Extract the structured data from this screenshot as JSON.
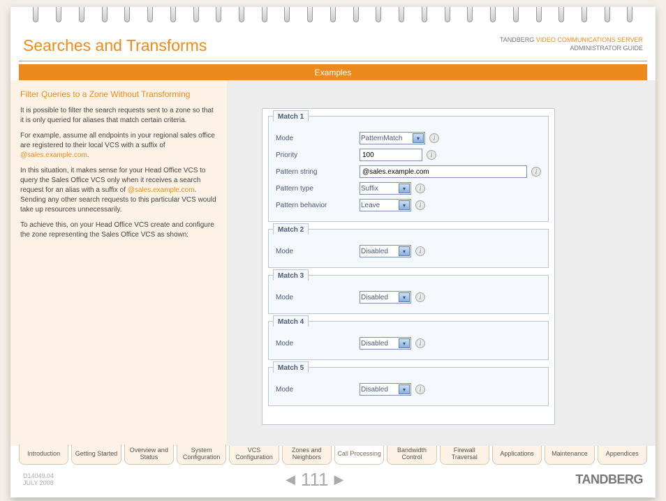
{
  "header": {
    "title": "Searches and Transforms",
    "product_line1_a": "TANDBERG",
    "product_line1_b": "VIDEO COMMUNICATIONS SERVER",
    "product_line2": "ADMINISTRATOR GUIDE",
    "bar_label": "Examples"
  },
  "left": {
    "heading": "Filter Queries to a Zone Without Transforming",
    "p1": "It is possible to filter the search requests sent to a zone so that it is only queried for aliases that match certain criteria.",
    "p2a": "For example, assume all endpoints in your regional sales office are registered to their local VCS with a suffix of ",
    "p2_link": "@sales.example.com",
    "p2b": ".",
    "p3a": "In this situation, it makes sense for your Head Office VCS to query the Sales Office VCS only when it receives a search request for an alias with a suffix of ",
    "p3_link": "@sales.example.com",
    "p3b": ". Sending any other search requests to this particular VCS would take up resources unnecessarily.",
    "p4": "To achieve this, on your Head Office VCS create and configure the zone representing the Sales Office VCS as shown:"
  },
  "form": {
    "match1": {
      "title": "Match 1",
      "mode_label": "Mode",
      "mode_value": "PatternMatch",
      "priority_label": "Priority",
      "priority_value": "100",
      "pattern_string_label": "Pattern string",
      "pattern_string_value": "@sales.example.com",
      "pattern_type_label": "Pattern type",
      "pattern_type_value": "Suffix",
      "pattern_behavior_label": "Pattern behavior",
      "pattern_behavior_value": "Leave"
    },
    "match2": {
      "title": "Match 2",
      "mode_label": "Mode",
      "mode_value": "Disabled"
    },
    "match3": {
      "title": "Match 3",
      "mode_label": "Mode",
      "mode_value": "Disabled"
    },
    "match4": {
      "title": "Match 4",
      "mode_label": "Mode",
      "mode_value": "Disabled"
    },
    "match5": {
      "title": "Match 5",
      "mode_label": "Mode",
      "mode_value": "Disabled"
    }
  },
  "tabs": [
    "Introduction",
    "Getting Started",
    "Overview and Status",
    "System Configuration",
    "VCS Configuration",
    "Zones and Neighbors",
    "Call Processing",
    "Bandwidth Control",
    "Firewall Traversal",
    "Applications",
    "Maintenance",
    "Appendices"
  ],
  "footer": {
    "doc_id": "D14049.04",
    "date": "JULY 2008",
    "page": "111",
    "brand": "TANDBERG"
  }
}
